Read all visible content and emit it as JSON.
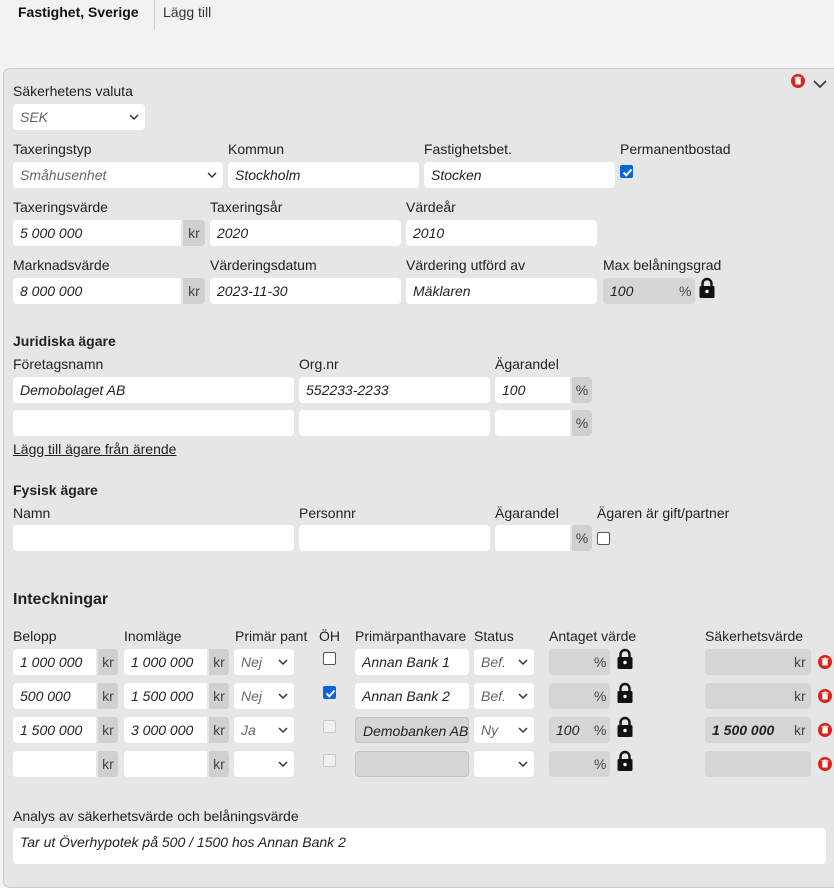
{
  "tabs": {
    "active": "Fastighet, Sverige",
    "other": "Lägg till"
  },
  "currency": {
    "label": "Säkerhetens valuta",
    "value": "SEK"
  },
  "taxering": {
    "typ_label": "Taxeringstyp",
    "typ_value": "Småhusenhet",
    "kommun_label": "Kommun",
    "kommun_value": "Stockholm",
    "fastighetsbet_label": "Fastighetsbet.",
    "fastighetsbet_value": "Stocken",
    "permanent_label": "Permanentbostad",
    "varde_label": "Taxeringsvärde",
    "varde_value": "5 000 000",
    "ar_label": "Taxeringsår",
    "ar_value": "2020",
    "vardear_label": "Värdeår",
    "vardear_value": "2010"
  },
  "marknad": {
    "varde_label": "Marknadsvärde",
    "varde_value": "8 000 000",
    "datum_label": "Värderingsdatum",
    "datum_value": "2023-11-30",
    "utford_label": "Värdering utförd av",
    "utford_value": "Mäklaren",
    "max_label": "Max belåningsgrad",
    "max_value": "100"
  },
  "units": {
    "kr": "kr",
    "pct": "%"
  },
  "juridiska": {
    "heading": "Juridiska ägare",
    "col_name": "Företagsnamn",
    "col_org": "Org.nr",
    "col_share": "Ägarandel",
    "rows": [
      {
        "name": "Demobolaget AB",
        "org": "552233-2233",
        "share": "100"
      },
      {
        "name": "",
        "org": "",
        "share": ""
      }
    ],
    "add_link": "Lägg till ägare från ärende"
  },
  "fysisk": {
    "heading": "Fysisk ägare",
    "col_name": "Namn",
    "col_pnr": "Personnr",
    "col_share": "Ägarandel",
    "col_partner": "Ägaren är gift/partner"
  },
  "inteckningar": {
    "heading": "Inteckningar",
    "cols": {
      "belopp": "Belopp",
      "inomlage": "Inomläge",
      "primar": "Primär pant",
      "oh": "ÖH",
      "panthavare": "Primärpanthavare",
      "status": "Status",
      "antaget": "Antaget värde",
      "sakerhet": "Säkerhetsvärde"
    },
    "rows": [
      {
        "belopp": "1 000 000",
        "inomlage": "1 000 000",
        "primar": "Nej",
        "panthavare": "Annan Bank 1",
        "status": "Bef.",
        "antaget": "",
        "sakerhet": ""
      },
      {
        "belopp": "500 000",
        "inomlage": "1 500 000",
        "primar": "Nej",
        "panthavare": "Annan Bank 2",
        "status": "Bef.",
        "antaget": "",
        "sakerhet": ""
      },
      {
        "belopp": "1 500 000",
        "inomlage": "3 000 000",
        "primar": "Ja",
        "panthavare": "Demobanken AB",
        "status": "Ny",
        "antaget": "100",
        "sakerhet": "1 500 000"
      },
      {
        "belopp": "",
        "inomlage": "",
        "primar": "",
        "panthavare": "",
        "status": "",
        "antaget": "",
        "sakerhet": ""
      }
    ]
  },
  "analys": {
    "label": "Analys av säkerhetsvärde och belåningsvärde",
    "value": "Tar ut Överhypotek på 500 / 1500 hos Annan Bank 2"
  }
}
